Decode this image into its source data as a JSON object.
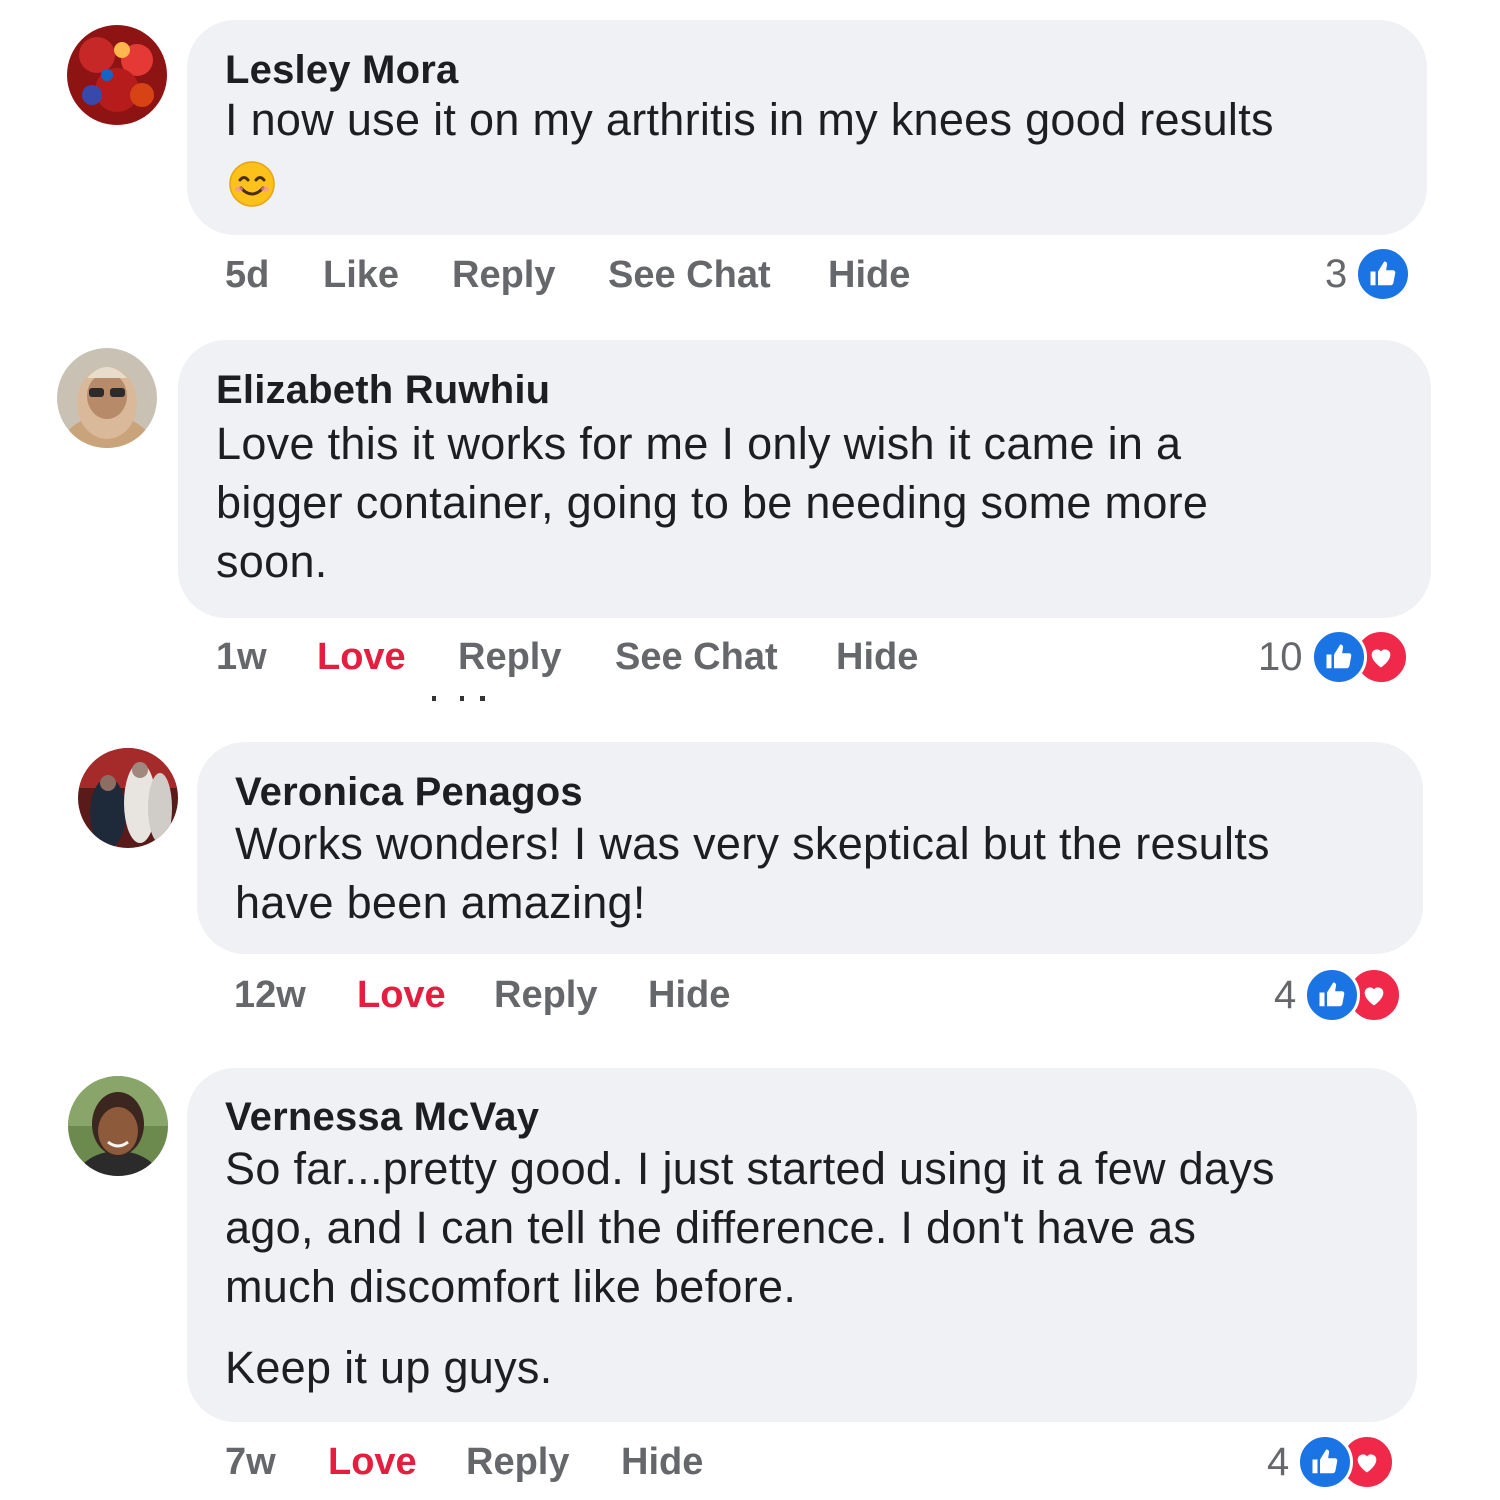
{
  "comments": [
    {
      "author": "Lesley Mora",
      "text_lines": [
        "I now use it on my arthritis in my knees good results"
      ],
      "emoji": "smiling-face-emoji",
      "time": "5d",
      "reaction_action": "Like",
      "reply": "Reply",
      "see_chat": "See Chat",
      "hide": "Hide",
      "reaction_count": "3",
      "reactions": [
        "like"
      ]
    },
    {
      "author": "Elizabeth Ruwhiu",
      "text_lines": [
        "Love this it works for me I only wish it came in a",
        "bigger container, going to be needing some more",
        "soon."
      ],
      "time": "1w",
      "reaction_action": "Love",
      "reply": "Reply",
      "see_chat": "See Chat",
      "hide": "Hide",
      "reaction_count": "10",
      "reactions": [
        "like",
        "love"
      ]
    },
    {
      "author": "Veronica Penagos",
      "text_lines": [
        "Works wonders! I was very skeptical but the results",
        "have been amazing!"
      ],
      "time": "12w",
      "reaction_action": "Love",
      "reply": "Reply",
      "hide": "Hide",
      "reaction_count": "4",
      "reactions": [
        "like",
        "love"
      ]
    },
    {
      "author": "Vernessa McVay",
      "text_lines": [
        "So far...pretty good. I just started using it a few days",
        "ago, and I can tell the difference. I don't have as",
        "much discomfort like before."
      ],
      "text_lines_2": [
        "Keep it up guys."
      ],
      "time": "7w",
      "reaction_action": "Love",
      "reply": "Reply",
      "hide": "Hide",
      "reaction_count": "4",
      "reactions": [
        "like",
        "love"
      ]
    }
  ],
  "colors": {
    "bubble": "#eff1f4",
    "action_text": "#65676b",
    "love": "#e41e3f",
    "like_badge": "#1b74e4",
    "love_badge": "#f02849"
  }
}
